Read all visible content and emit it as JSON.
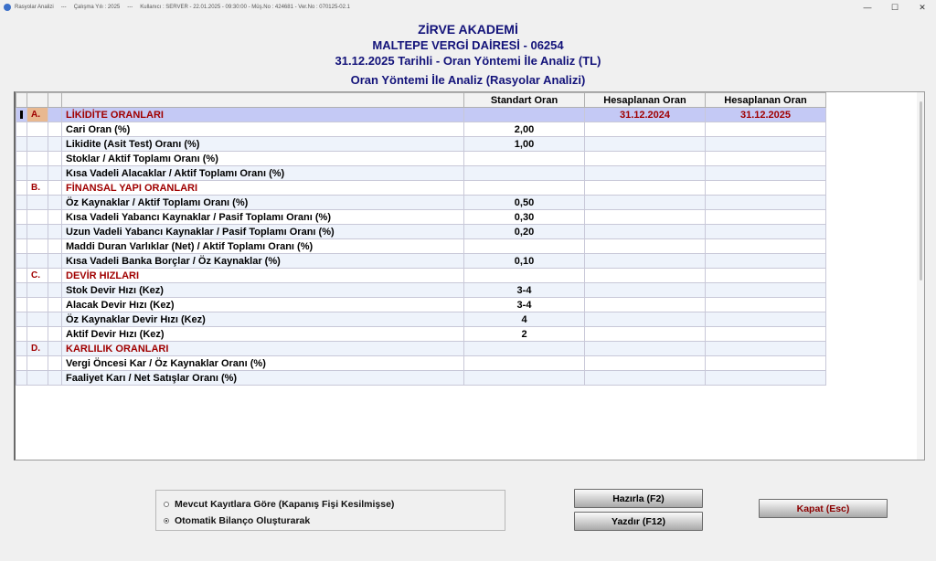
{
  "window": {
    "title_items": [
      "Rasyolar Analizi",
      "---",
      "Çalışma Yılı : 2025",
      "---",
      "Kullanıcı : SERVER - 22.01.2025 - 09:30:00 - Müş.No : 424681 - Ver.No : 070125-02.1"
    ],
    "controls": [
      "—",
      "☐",
      "✕"
    ]
  },
  "header": {
    "company": "ZİRVE AKADEMİ",
    "tax_office": "MALTEPE VERGİ DAİRESİ - 06254",
    "report_title": "31.12.2025 Tarihli - Oran Yöntemi İle Analiz (TL)",
    "subtitle": "Oran Yöntemi İle Analiz (Rasyolar Analizi)"
  },
  "grid": {
    "columns": [
      "",
      "",
      "",
      "",
      "Standart Oran",
      "Hesaplanan Oran",
      "Hesaplanan Oran"
    ],
    "rows": [
      {
        "sec": "A.",
        "name": "LİKİDİTE ORANLARI",
        "std": "",
        "h1": "31.12.2024",
        "h2": "31.12.2025",
        "type": "section",
        "selected": true
      },
      {
        "sec": "",
        "name": "Cari Oran (%)",
        "std": "2,00",
        "h1": "",
        "h2": ""
      },
      {
        "sec": "",
        "name": "Likidite (Asit Test) Oranı (%)",
        "std": "1,00",
        "h1": "",
        "h2": ""
      },
      {
        "sec": "",
        "name": "Stoklar / Aktif Toplamı Oranı (%)",
        "std": "",
        "h1": "",
        "h2": ""
      },
      {
        "sec": "",
        "name": "Kısa Vadeli Alacaklar / Aktif Toplamı Oranı (%)",
        "std": "",
        "h1": "",
        "h2": ""
      },
      {
        "sec": "B.",
        "name": "FİNANSAL YAPI ORANLARI",
        "std": "",
        "h1": "",
        "h2": "",
        "type": "section"
      },
      {
        "sec": "",
        "name": "Öz Kaynaklar / Aktif Toplamı Oranı (%)",
        "std": "0,50",
        "h1": "",
        "h2": ""
      },
      {
        "sec": "",
        "name": "Kısa Vadeli Yabancı Kaynaklar / Pasif Toplamı Oranı (%)",
        "std": "0,30",
        "h1": "",
        "h2": ""
      },
      {
        "sec": "",
        "name": "Uzun Vadeli Yabancı Kaynaklar / Pasif Toplamı Oranı (%)",
        "std": "0,20",
        "h1": "",
        "h2": ""
      },
      {
        "sec": "",
        "name": "Maddi Duran Varlıklar (Net) / Aktif Toplamı Oranı (%)",
        "std": "",
        "h1": "",
        "h2": ""
      },
      {
        "sec": "",
        "name": "Kısa Vadeli Banka Borçlar / Öz Kaynaklar (%)",
        "std": "0,10",
        "h1": "",
        "h2": ""
      },
      {
        "sec": "C.",
        "name": "DEVİR HIZLARI",
        "std": "",
        "h1": "",
        "h2": "",
        "type": "section"
      },
      {
        "sec": "",
        "name": "Stok Devir Hızı (Kez)",
        "std": "3-4",
        "h1": "",
        "h2": ""
      },
      {
        "sec": "",
        "name": "Alacak Devir Hızı (Kez)",
        "std": "3-4",
        "h1": "",
        "h2": ""
      },
      {
        "sec": "",
        "name": "Öz Kaynaklar Devir Hızı (Kez)",
        "std": "4",
        "h1": "",
        "h2": ""
      },
      {
        "sec": "",
        "name": "Aktif Devir Hızı (Kez)",
        "std": "2",
        "h1": "",
        "h2": ""
      },
      {
        "sec": "D.",
        "name": "KARLILIK ORANLARI",
        "std": "",
        "h1": "",
        "h2": "",
        "type": "section"
      },
      {
        "sec": "",
        "name": "Vergi Öncesi Kar / Öz Kaynaklar Oranı (%)",
        "std": "",
        "h1": "",
        "h2": ""
      },
      {
        "sec": "",
        "name": "Faaliyet Karı / Net Satışlar Oranı (%)",
        "std": "",
        "h1": "",
        "h2": ""
      }
    ]
  },
  "options": {
    "items": [
      {
        "label": "Mevcut Kayıtlara Göre (Kapanış Fişi Kesilmişse)",
        "selected": false
      },
      {
        "label": "Otomatik Bilanço Oluşturarak",
        "selected": true
      }
    ]
  },
  "buttons": {
    "prepare": "Hazırla (F2)",
    "print": "Yazdır (F12)",
    "close": "Kapat (Esc)"
  },
  "colors": {
    "header_text": "#13137a",
    "section_text": "#a00000",
    "selected_row": "#c4c9f5",
    "close_button_text": "#8b0000"
  }
}
